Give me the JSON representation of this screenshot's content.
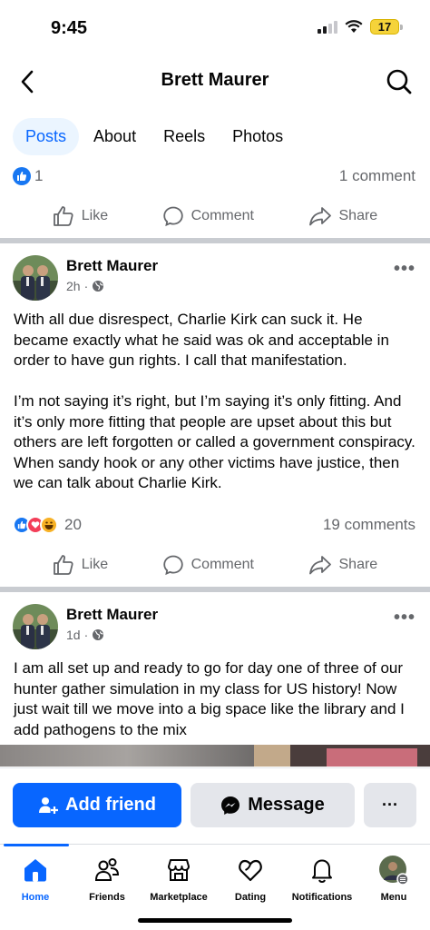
{
  "status": {
    "time": "9:45",
    "battery": "17"
  },
  "header": {
    "title": "Brett Maurer"
  },
  "tabs": [
    "Posts",
    "About",
    "Reels",
    "Photos"
  ],
  "prev_post": {
    "reaction_count": "1",
    "comments": "1 comment"
  },
  "actions": {
    "like": "Like",
    "comment": "Comment",
    "share": "Share"
  },
  "post1": {
    "author": "Brett Maurer",
    "time": "2h",
    "text": "With all due disrespect, Charlie Kirk can suck it. He became exactly what he said was ok and acceptable in order to have gun rights. I call that manifestation.\n\nI’m not saying it’s right, but I’m saying it’s only fitting. And it’s only more fitting that people are upset about this but others are left forgotten or called a government conspiracy. When sandy hook or any other victims have justice, then we can talk about Charlie Kirk.",
    "reaction_count": "20",
    "comments": "19 comments"
  },
  "post2": {
    "author": "Brett Maurer",
    "time": "1d",
    "text": "I am all set up and ready to go for day one of three of our hunter gather simulation in my class for US history!  Now just wait till we move into a big space like the library and I add pathogens to the mix"
  },
  "cta": {
    "add_friend": "Add friend",
    "message": "Message",
    "more": "···"
  },
  "tabbar": [
    "Home",
    "Friends",
    "Marketplace",
    "Dating",
    "Notifications",
    "Menu"
  ],
  "colors": {
    "accent": "#0866ff",
    "secondary_text": "#65676b",
    "button_gray": "#e4e6eb"
  }
}
